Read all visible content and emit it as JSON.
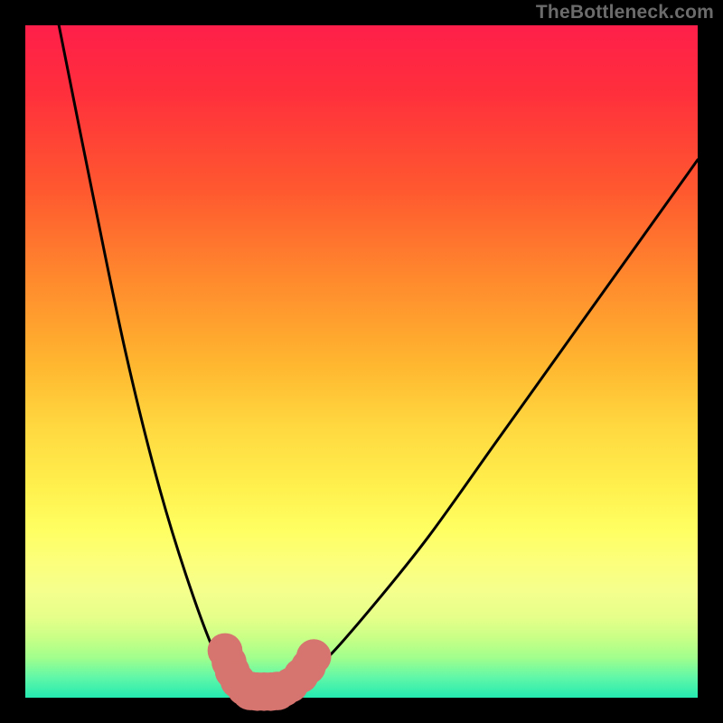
{
  "watermark": "TheBottleneck.com",
  "colors": {
    "frame": "#000000",
    "gradient_top": "#ff1f4a",
    "gradient_bottom": "#24eab0",
    "curve_stroke": "#000000",
    "scatter_fill": "#d6746f"
  },
  "chart_data": {
    "type": "line",
    "title": "",
    "xlabel": "",
    "ylabel": "",
    "xlim": [
      0,
      100
    ],
    "ylim": [
      0,
      100
    ],
    "series": [
      {
        "name": "left-curve",
        "x": [
          5,
          10,
          15,
          20,
          25,
          29,
          32,
          35,
          36,
          37
        ],
        "y": [
          100,
          75,
          51,
          31,
          15,
          5,
          2,
          1,
          1,
          1
        ]
      },
      {
        "name": "right-curve",
        "x": [
          37,
          38,
          40,
          45,
          52,
          60,
          70,
          80,
          90,
          100
        ],
        "y": [
          1,
          1,
          2,
          6,
          14,
          24,
          38,
          52,
          66,
          80
        ]
      }
    ],
    "scatter": {
      "name": "bottom-scatter",
      "points": [
        {
          "x": 29.7,
          "y": 7.0,
          "r": 2.0
        },
        {
          "x": 30.3,
          "y": 5.3,
          "r": 2.0
        },
        {
          "x": 30.8,
          "y": 3.9,
          "r": 2.0
        },
        {
          "x": 31.6,
          "y": 2.5,
          "r": 2.0
        },
        {
          "x": 32.6,
          "y": 1.4,
          "r": 2.0
        },
        {
          "x": 33.5,
          "y": 1.0,
          "r": 2.2
        },
        {
          "x": 34.5,
          "y": 0.9,
          "r": 2.2
        },
        {
          "x": 35.5,
          "y": 0.9,
          "r": 2.2
        },
        {
          "x": 36.5,
          "y": 0.9,
          "r": 2.2
        },
        {
          "x": 37.5,
          "y": 1.0,
          "r": 2.2
        },
        {
          "x": 38.5,
          "y": 1.3,
          "r": 2.0
        },
        {
          "x": 39.5,
          "y": 1.9,
          "r": 2.0
        },
        {
          "x": 41.0,
          "y": 3.3,
          "r": 2.0
        },
        {
          "x": 42.1,
          "y": 4.6,
          "r": 2.0
        },
        {
          "x": 42.9,
          "y": 6.1,
          "r": 2.0
        }
      ]
    }
  }
}
